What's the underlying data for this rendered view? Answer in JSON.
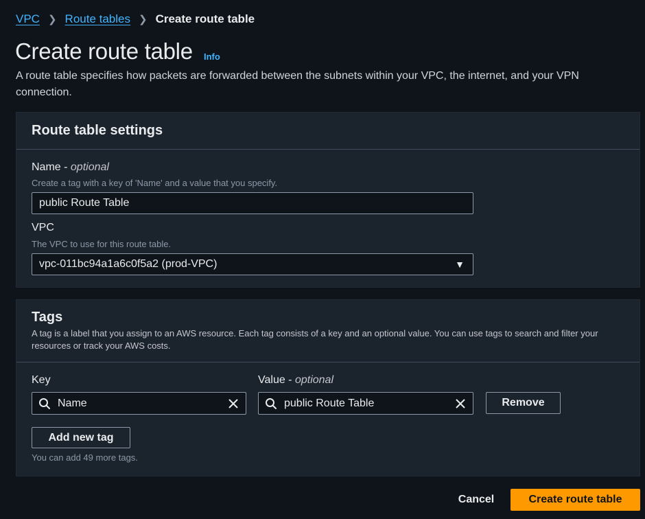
{
  "breadcrumb": {
    "items": [
      "VPC",
      "Route tables"
    ],
    "current": "Create route table"
  },
  "page": {
    "title": "Create route table",
    "info": "Info",
    "description": "A route table specifies how packets are forwarded between the subnets within your VPC, the internet, and your VPN connection."
  },
  "settings": {
    "title": "Route table settings",
    "name_label": "Name",
    "name_optional": "optional",
    "name_hint": "Create a tag with a key of 'Name' and a value that you specify.",
    "name_value": "public Route Table",
    "vpc_label": "VPC",
    "vpc_hint": "The VPC to use for this route table.",
    "vpc_value": "vpc-011bc94a1a6c0f5a2 (prod-VPC)"
  },
  "tags": {
    "title": "Tags",
    "description": "A tag is a label that you assign to an AWS resource. Each tag consists of a key and an optional value. You can use tags to search and filter your resources or track your AWS costs.",
    "key_label": "Key",
    "value_label": "Value",
    "value_optional": "optional",
    "rows": [
      {
        "key": "Name",
        "value": "public Route Table"
      }
    ],
    "remove_label": "Remove",
    "add_label": "Add new tag",
    "limit_note": "You can add 49 more tags."
  },
  "footer": {
    "cancel_label": "Cancel",
    "submit_label": "Create route table"
  },
  "colors": {
    "accent": "#ff9900",
    "link": "#42b4ff",
    "background": "#0f141a",
    "panel": "#1b232d"
  }
}
